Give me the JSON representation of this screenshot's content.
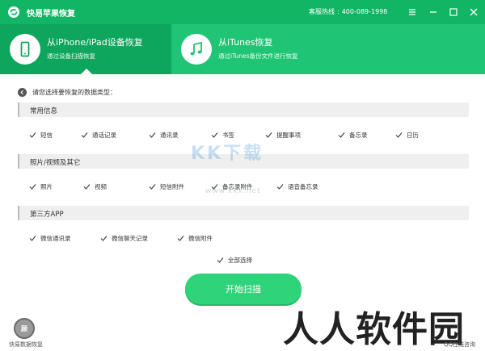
{
  "window": {
    "title": "快易苹果恢复",
    "hotline_label": "客服热线",
    "hotline_number": "400-089-1998",
    "colors": {
      "primary": "#11b563",
      "header": "#1fc574",
      "active_tab": "#0ea55c",
      "start_button": "#2fd37a"
    }
  },
  "modes": [
    {
      "title": "从iPhone/iPad设备恢复",
      "subtitle": "通过设备扫描恢复",
      "icon": "phone-icon",
      "active": true
    },
    {
      "title": "从iTunes恢复",
      "subtitle": "通过iTunes备份文件进行恢复",
      "icon": "music-note-icon",
      "active": false
    }
  ],
  "prompt": "请您选择要恢复的数据类型：",
  "sections": [
    {
      "title": "常用信息",
      "items": [
        "短信",
        "通话记录",
        "通讯录",
        "书签",
        "提醒事项",
        "备忘录",
        "日历"
      ]
    },
    {
      "title": "照片/视频及其它",
      "items": [
        "照片",
        "视频",
        "短信附件",
        "备忘录附件",
        "语音备忘录"
      ]
    },
    {
      "title": "第三方APP",
      "items": [
        "微信通讯录",
        "微信聊天记录",
        "微信附件"
      ]
    }
  ],
  "select_all_label": "全部选择",
  "start_button_label": "开始扫描",
  "footer": {
    "logo_text": "顾",
    "left": "快易数据恢复",
    "right": "QQ在线咨询"
  },
  "watermarks": {
    "main": "KK下载",
    "url": "www.kkx.net",
    "brand": "人人软件园"
  }
}
